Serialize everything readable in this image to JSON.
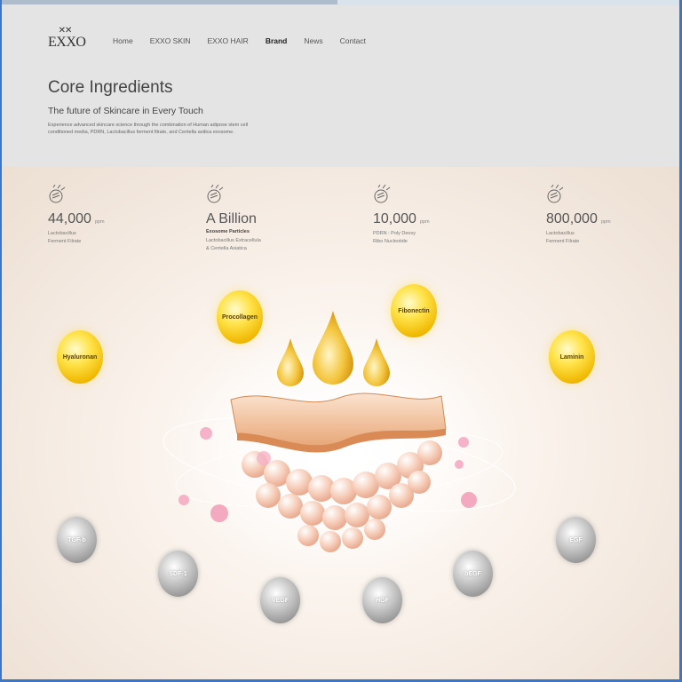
{
  "brand": {
    "logo_text": "EXXO",
    "logo_mark": "✕✕"
  },
  "nav": {
    "items": [
      {
        "label": "Home"
      },
      {
        "label": "EXXO SKIN"
      },
      {
        "label": "EXXO HAIR"
      },
      {
        "label": "Brand"
      },
      {
        "label": "News"
      },
      {
        "label": "Contact"
      }
    ],
    "active": "Brand"
  },
  "header": {
    "title": "Core Ingredients",
    "subtitle": "The future of Skincare in Every Touch",
    "description": "Experience advanced skincare science through the combination of Human adipose stem cell conditioned media, PDRN, Lactobacillus ferment filrate, and Centella asitica exosome."
  },
  "stats": [
    {
      "value": "44,000",
      "unit": "ppm",
      "bold": "",
      "line1": "Lactobacillus",
      "line2": "Ferment Filrate"
    },
    {
      "value": "A Billion",
      "unit": "",
      "bold": "Exosome Particles",
      "line1": "Lactobacillus Extracellula",
      "line2": "& Centella Asiatica"
    },
    {
      "value": "10,000",
      "unit": "ppm",
      "bold": "",
      "line1": "PDRN : Poly Deoxy",
      "line2": "Ribo Nucleotide"
    },
    {
      "value": "800,000",
      "unit": "ppm",
      "bold": "",
      "line1": "Lactobacillus",
      "line2": "Ferment Filrate"
    }
  ],
  "gold_ingredients": [
    {
      "label": "Procollagen"
    },
    {
      "label": "Fibonectin"
    },
    {
      "label": "Hyaluronan"
    },
    {
      "label": "Laminin"
    }
  ],
  "growth_factors": [
    {
      "label": "TGF-b"
    },
    {
      "label": "SDF-1"
    },
    {
      "label": "VEGF"
    },
    {
      "label": "HGF"
    },
    {
      "label": "bEGF"
    },
    {
      "label": "EGF"
    }
  ],
  "colors": {
    "gold": "#f0b800",
    "silver": "#9b9b9b",
    "hero_bg": "#f4ebe2",
    "header_bg": "#e4e4e4"
  }
}
